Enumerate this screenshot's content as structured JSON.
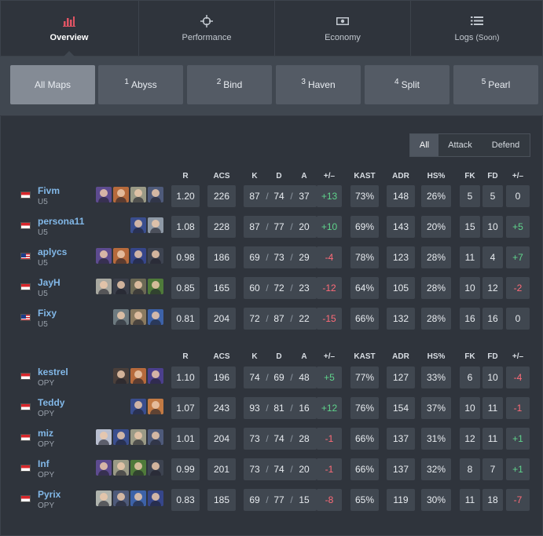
{
  "tabs": [
    {
      "label": "Overview",
      "note": "",
      "icon": "bar-chart-icon",
      "active": true
    },
    {
      "label": "Performance",
      "note": "",
      "icon": "crosshair-icon",
      "active": false
    },
    {
      "label": "Economy",
      "note": "",
      "icon": "money-icon",
      "active": false
    },
    {
      "label": "Logs",
      "note": "(Soon)",
      "icon": "list-icon",
      "active": false
    }
  ],
  "maps": [
    {
      "num": "",
      "name": "All Maps",
      "active": true
    },
    {
      "num": "1",
      "name": "Abyss",
      "active": false
    },
    {
      "num": "2",
      "name": "Bind",
      "active": false
    },
    {
      "num": "3",
      "name": "Haven",
      "active": false
    },
    {
      "num": "4",
      "name": "Split",
      "active": false
    },
    {
      "num": "5",
      "name": "Pearl",
      "active": false
    }
  ],
  "sides": [
    {
      "label": "All",
      "active": true
    },
    {
      "label": "Attack",
      "active": false
    },
    {
      "label": "Defend",
      "active": false
    }
  ],
  "columns": {
    "r": "R",
    "acs": "ACS",
    "k": "K",
    "d": "D",
    "a": "A",
    "pm": "+/–",
    "kast": "KAST",
    "adr": "ADR",
    "hs": "HS%",
    "fk": "FK",
    "fd": "FD",
    "fpm": "+/–"
  },
  "teams": [
    {
      "players": [
        {
          "name": "Fivm",
          "team": "U5",
          "flag": "sg",
          "agents": [
            "#5d4b8f",
            "#b66a3c",
            "#9a9a86",
            "#4e5a7a"
          ],
          "r": "1.20",
          "acs": "226",
          "k": "87",
          "d": "74",
          "a": "37",
          "pm": "+13",
          "kast": "73%",
          "adr": "148",
          "hs": "26%",
          "fk": "5",
          "fd": "5",
          "fpm": "0"
        },
        {
          "name": "persona11",
          "team": "U5",
          "flag": "sg",
          "agents": [
            "#3a4e8e",
            "#8e99a6"
          ],
          "r": "1.08",
          "acs": "228",
          "k": "87",
          "d": "77",
          "a": "20",
          "pm": "+10",
          "kast": "69%",
          "adr": "143",
          "hs": "20%",
          "fk": "15",
          "fd": "10",
          "fpm": "+5"
        },
        {
          "name": "aplycs",
          "team": "U5",
          "flag": "my",
          "agents": [
            "#5d4b8f",
            "#b66a3c",
            "#36468a",
            "#3d4350"
          ],
          "r": "0.98",
          "acs": "186",
          "k": "69",
          "d": "73",
          "a": "29",
          "pm": "-4",
          "kast": "78%",
          "adr": "123",
          "hs": "28%",
          "fk": "11",
          "fd": "4",
          "fpm": "+7"
        },
        {
          "name": "JayH",
          "team": "U5",
          "flag": "sg",
          "agents": [
            "#a8a8a0",
            "#3b3f4a",
            "#6c6a55",
            "#4f7a3a"
          ],
          "r": "0.85",
          "acs": "165",
          "k": "60",
          "d": "72",
          "a": "23",
          "pm": "-12",
          "kast": "64%",
          "adr": "105",
          "hs": "28%",
          "fk": "10",
          "fd": "12",
          "fpm": "-2"
        },
        {
          "name": "Fixy",
          "team": "U5",
          "flag": "my",
          "agents": [
            "#6d7a80",
            "#8a7a60",
            "#3d62a8"
          ],
          "r": "0.81",
          "acs": "204",
          "k": "72",
          "d": "87",
          "a": "22",
          "pm": "-15",
          "kast": "66%",
          "adr": "132",
          "hs": "28%",
          "fk": "16",
          "fd": "16",
          "fpm": "0"
        }
      ]
    },
    {
      "players": [
        {
          "name": "kestrel",
          "team": "OPY",
          "flag": "sg",
          "agents": [
            "#4a3f3a",
            "#b66a3c",
            "#4b3f8c"
          ],
          "r": "1.10",
          "acs": "196",
          "k": "74",
          "d": "69",
          "a": "48",
          "pm": "+5",
          "kast": "77%",
          "adr": "127",
          "hs": "33%",
          "fk": "6",
          "fd": "10",
          "fpm": "-4"
        },
        {
          "name": "Teddy",
          "team": "OPY",
          "flag": "sg",
          "agents": [
            "#3a4e8e",
            "#c27a44"
          ],
          "r": "1.07",
          "acs": "243",
          "k": "93",
          "d": "81",
          "a": "16",
          "pm": "+12",
          "kast": "76%",
          "adr": "154",
          "hs": "37%",
          "fk": "10",
          "fd": "11",
          "fpm": "-1"
        },
        {
          "name": "miz",
          "team": "OPY",
          "flag": "sg",
          "agents": [
            "#b9bfd0",
            "#3a4e8e",
            "#9a9a86",
            "#4e5a7a"
          ],
          "r": "1.01",
          "acs": "204",
          "k": "73",
          "d": "74",
          "a": "28",
          "pm": "-1",
          "kast": "66%",
          "adr": "137",
          "hs": "31%",
          "fk": "12",
          "fd": "11",
          "fpm": "+1"
        },
        {
          "name": "Inf",
          "team": "OPY",
          "flag": "sg",
          "agents": [
            "#5d4b8f",
            "#9a9a86",
            "#4f7a3a",
            "#3d4350"
          ],
          "r": "0.99",
          "acs": "201",
          "k": "73",
          "d": "74",
          "a": "20",
          "pm": "-1",
          "kast": "66%",
          "adr": "137",
          "hs": "32%",
          "fk": "8",
          "fd": "7",
          "fpm": "+1"
        },
        {
          "name": "Pyrix",
          "team": "OPY",
          "flag": "sg",
          "agents": [
            "#b0b4ae",
            "#4e5a7a",
            "#3d62a8",
            "#36468a"
          ],
          "r": "0.83",
          "acs": "185",
          "k": "69",
          "d": "77",
          "a": "15",
          "pm": "-8",
          "kast": "65%",
          "adr": "119",
          "hs": "30%",
          "fk": "11",
          "fd": "18",
          "fpm": "-7"
        }
      ]
    }
  ],
  "colors": {
    "positive": "#5fd38b",
    "negative": "#ff6b78",
    "player_name": "#82b8e8",
    "active_icon": "#e05464"
  }
}
